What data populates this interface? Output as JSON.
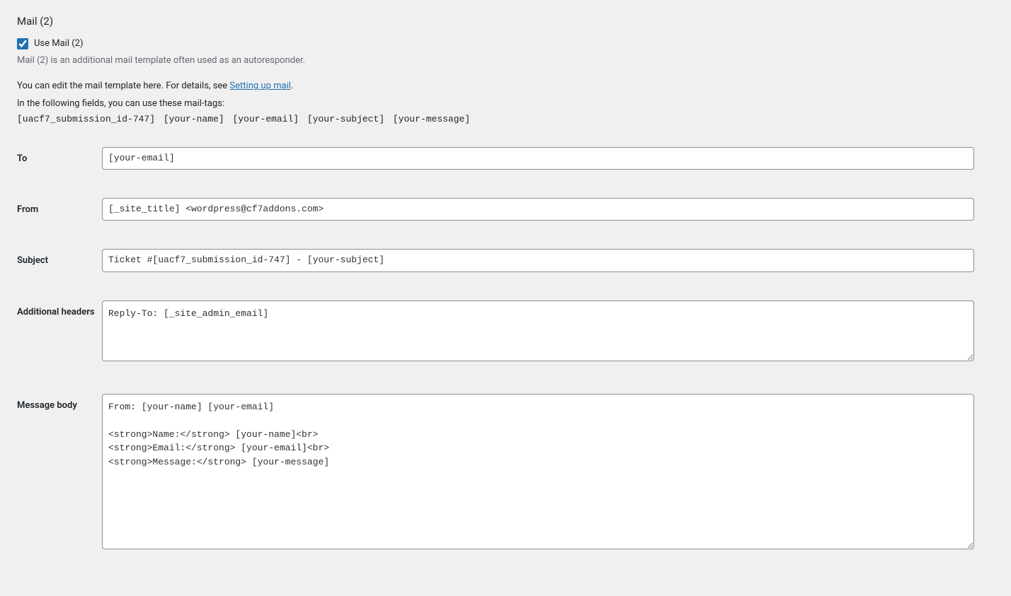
{
  "mail2": {
    "title": "Mail (2)",
    "checkbox_label": "Use Mail (2)",
    "description": "Mail (2) is an additional mail template often used as an autoresponder.",
    "help_text_prefix": "You can edit the mail template here. For details, see ",
    "help_link_text": "Setting up mail",
    "help_text_suffix": ".",
    "mail_tags_intro": "In the following fields, you can use these mail-tags:",
    "mail_tags": "[uacf7_submission_id-747] [your-name] [your-email] [your-subject] [your-message]",
    "fields": {
      "to": {
        "label": "To",
        "value": "[your-email]"
      },
      "from": {
        "label": "From",
        "value": "[_site_title] <wordpress@cf7addons.com>"
      },
      "subject": {
        "label": "Subject",
        "value": "Ticket #[uacf7_submission_id-747] - [your-subject]"
      },
      "additional_headers": {
        "label": "Additional headers",
        "value": "Reply-To: [_site_admin_email]"
      },
      "message_body": {
        "label": "Message body",
        "value": "From: [your-name] [your-email]\n\n<strong>Name:</strong> [your-name]<br>\n<strong>Email:</strong> [your-email]<br>\n<strong>Message:</strong> [your-message]"
      }
    }
  }
}
